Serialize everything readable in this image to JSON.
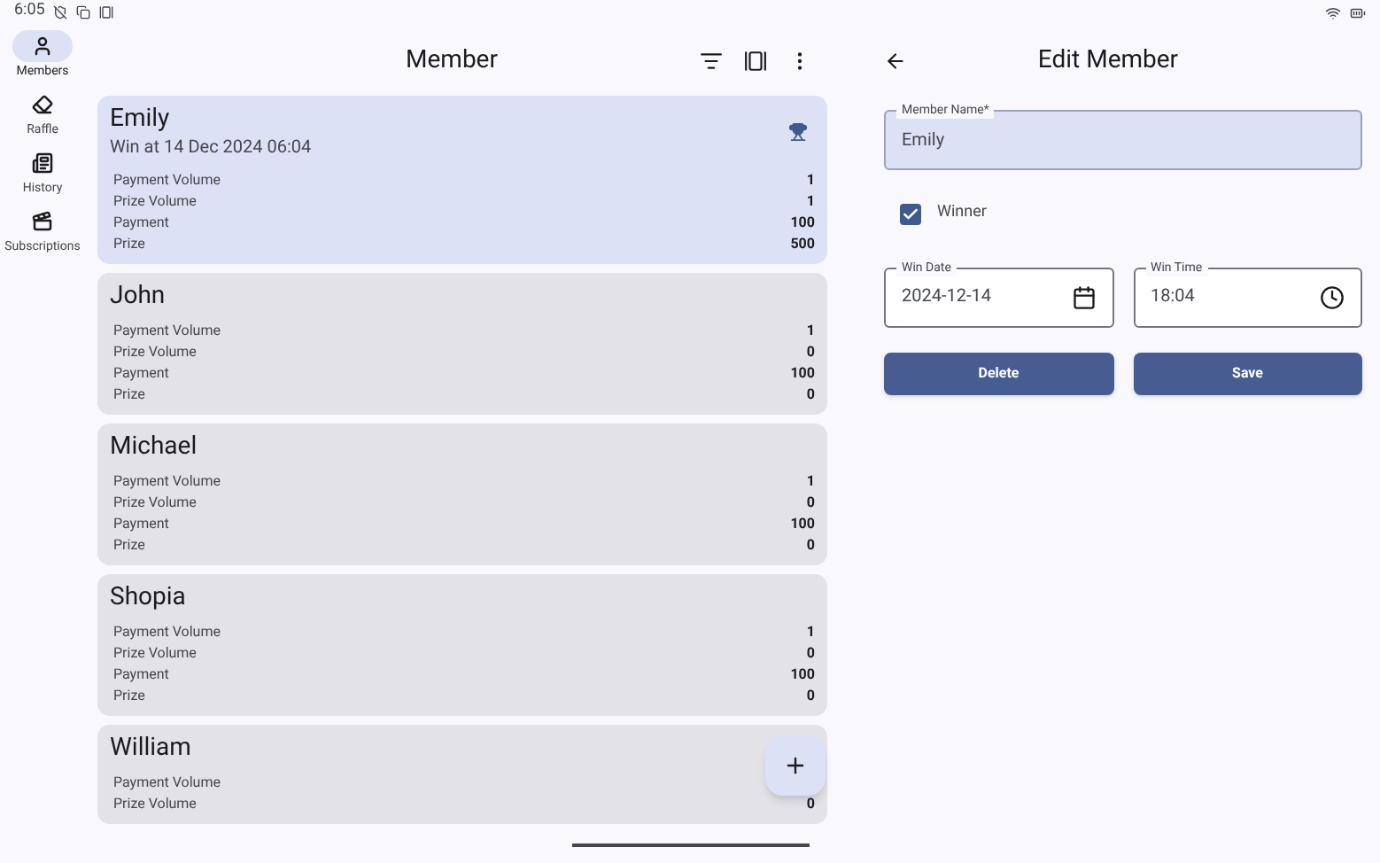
{
  "status_bar": {
    "time": "6:05"
  },
  "nav": [
    {
      "label": "Members",
      "selected": true
    },
    {
      "label": "Raffle",
      "selected": false
    },
    {
      "label": "History",
      "selected": false
    },
    {
      "label": "Subscriptions",
      "selected": false
    }
  ],
  "list": {
    "title": "Member",
    "members": [
      {
        "name": "Emily",
        "subtitle": "Win at 14 Dec 2024 06:04",
        "winner": true,
        "selected": true,
        "stats": [
          {
            "label": "Payment Volume",
            "value": "1"
          },
          {
            "label": "Prize Volume",
            "value": "1"
          },
          {
            "label": "Payment",
            "value": "100"
          },
          {
            "label": "Prize",
            "value": "500"
          }
        ]
      },
      {
        "name": "John",
        "winner": false,
        "selected": false,
        "stats": [
          {
            "label": "Payment Volume",
            "value": "1"
          },
          {
            "label": "Prize Volume",
            "value": "0"
          },
          {
            "label": "Payment",
            "value": "100"
          },
          {
            "label": "Prize",
            "value": "0"
          }
        ]
      },
      {
        "name": "Michael",
        "winner": false,
        "selected": false,
        "stats": [
          {
            "label": "Payment Volume",
            "value": "1"
          },
          {
            "label": "Prize Volume",
            "value": "0"
          },
          {
            "label": "Payment",
            "value": "100"
          },
          {
            "label": "Prize",
            "value": "0"
          }
        ]
      },
      {
        "name": "Shopia",
        "winner": false,
        "selected": false,
        "stats": [
          {
            "label": "Payment Volume",
            "value": "1"
          },
          {
            "label": "Prize Volume",
            "value": "0"
          },
          {
            "label": "Payment",
            "value": "100"
          },
          {
            "label": "Prize",
            "value": "0"
          }
        ]
      },
      {
        "name": "William",
        "winner": false,
        "selected": false,
        "stats": [
          {
            "label": "Payment Volume"
          },
          {
            "label": "Prize Volume",
            "value": "0"
          }
        ]
      }
    ]
  },
  "editor": {
    "title": "Edit Member",
    "name_field": {
      "label": "Member Name*",
      "value": "Emily"
    },
    "winner": {
      "label": "Winner",
      "checked": true
    },
    "win_date": {
      "label": "Win Date",
      "value": "2024-12-14"
    },
    "win_time": {
      "label": "Win Time",
      "value": "18:04"
    },
    "buttons": [
      "Delete",
      "Save"
    ]
  }
}
